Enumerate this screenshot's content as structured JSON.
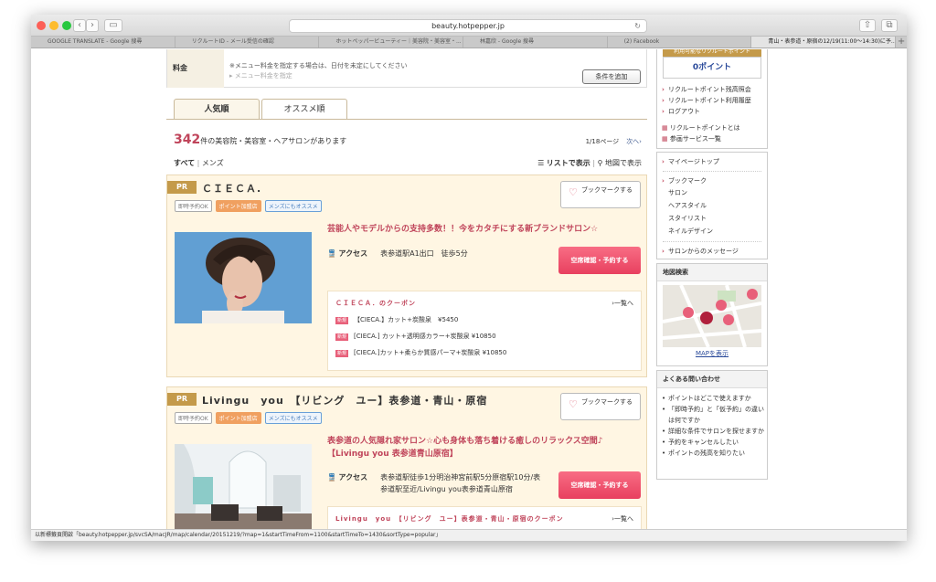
{
  "browser": {
    "url": "beauty.hotpepper.jp",
    "tabs": [
      "GOOGLE TRANSLATE - Google 搜尋",
      "リクルートID - メール受信の確認",
      "ホットペッパービューティー｜美容院・美容室・...",
      "林嘉欣 - Google 搜尋",
      "(2) Facebook",
      "青山・表参道・原宿の12/19(11:00〜14:30)に予..."
    ],
    "add_tab": "+",
    "nav_back": "‹",
    "nav_fwd": "›"
  },
  "search": {
    "fee_label": "料金",
    "fee_note": "※メニュー料金を指定する場合は、日付を未定にしてください",
    "fee_placeholder": "メニュー料金を指定",
    "add_condition": "条件を追加"
  },
  "sort": {
    "tab_popular": "人気順",
    "tab_recommend": "オススメ順"
  },
  "results": {
    "count": "342",
    "count_suffix": "件の美容院・美容室・ヘアサロンがあります",
    "page": "1/18ページ",
    "next": "次へ›",
    "filter_all": "すべて",
    "filter_sep": "|",
    "filter_mens": "メンズ",
    "list_view": "リストで表示",
    "map_view": "地図で表示"
  },
  "salons": [
    {
      "pr": "PR",
      "name": "ＣＩＥＣＡ.",
      "bookmark": "ブックマークする",
      "badges": [
        "即時予約OK",
        "ポイント加盟店",
        "メンズにもオススメ"
      ],
      "catch": "芸能人やモデルからの支持多数！！今をカタチにする新ブランドサロン☆",
      "access_label": "アクセス",
      "access": "表参道駅A1出口　徒歩5分",
      "reserve": "空席確認・予約する",
      "coupon_title": "ＣＩＥＣＡ．のクーポン",
      "coupon_all": "›一覧へ",
      "coupons": [
        {
          "tag": "新規",
          "text": "【CIECA.】カット+炭酸泉　¥5450"
        },
        {
          "tag": "新規",
          "text": "[CIECA.] カット+透明感カラー+炭酸泉 ¥10850"
        },
        {
          "tag": "新規",
          "text": "[CIECA.]カット+柔らか質感パーマ+炭酸泉 ¥10850"
        }
      ]
    },
    {
      "pr": "PR",
      "name": "Livingu　you　【リビング　ユー】表参道・青山・原宿",
      "bookmark": "ブックマークする",
      "badges": [
        "即時予約OK",
        "ポイント加盟店",
        "メンズにもオススメ"
      ],
      "catch": "表参道の人気隠れ家サロン☆心も身体も落ち着ける癒しのリラックス空間♪【Livingu you 表参道青山原宿】",
      "access_label": "アクセス",
      "access": "表参道駅徒歩1分明治神宮前駅5分原宿駅10分/表参道駅至近/Livingu you表参道青山原宿",
      "reserve": "空席確認・予約する",
      "coupon_title": "Livingu　you　【リビング　ユー】表参道・青山・原宿のクーポン",
      "coupon_all": "›一覧へ"
    }
  ],
  "sidebar": {
    "points_header": "利用可能なリクルートポイント",
    "points_value": "0ポイント",
    "links1": [
      "リクルートポイント残高照会",
      "リクルートポイント利用履歴",
      "ログアウト"
    ],
    "links2": [
      "リクルートポイントとは",
      "参画サービス一覧"
    ],
    "mypage": "マイページトップ",
    "bookmark": "ブックマーク",
    "bm_subs": [
      "サロン",
      "ヘアスタイル",
      "スタイリスト",
      "ネイルデザイン"
    ],
    "messages": "サロンからのメッセージ",
    "map_header": "地図検索",
    "map_link": "MAPを表示",
    "faq_header": "よくある問い合わせ",
    "faq": [
      "ポイントはどこで使えますか",
      "「即時予約」と「仮予約」の違いは何ですか",
      "詳細な条件でサロンを探せますか",
      "予約をキャンセルしたい",
      "ポイントの残高を知りたい"
    ]
  },
  "status_bar": "以新標籤頁開啟「beauty.hotpepper.jp/svcSA/macJR/map/calendar/20151219/?map=1&startTimeFrom=1100&startTimeTo=1430&sortType=popular」",
  "colors": {
    "accent": "#c0455b",
    "reserve": "#e8405f",
    "card_bg": "#fff6e3",
    "pr_tag": "#c49a4a",
    "link": "#2a4a9a"
  }
}
